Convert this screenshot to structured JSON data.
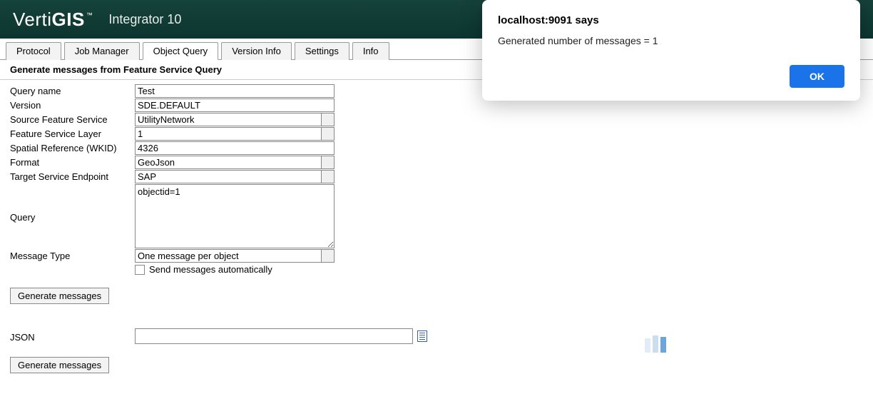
{
  "header": {
    "logo_part1": "Verti",
    "logo_part2": "GIS",
    "trademark": "™",
    "app_name": "Integrator 10"
  },
  "tabs": [
    {
      "label": "Protocol",
      "active": false
    },
    {
      "label": "Job Manager",
      "active": false
    },
    {
      "label": "Object Query",
      "active": true
    },
    {
      "label": "Version Info",
      "active": false
    },
    {
      "label": "Settings",
      "active": false
    },
    {
      "label": "Info",
      "active": false
    }
  ],
  "panel": {
    "title": "Generate messages from Feature Service Query"
  },
  "form": {
    "query_name": {
      "label": "Query name",
      "value": "Test"
    },
    "version": {
      "label": "Version",
      "value": "SDE.DEFAULT"
    },
    "source_fs": {
      "label": "Source Feature Service",
      "value": "UtilityNetwork"
    },
    "fs_layer": {
      "label": "Feature Service Layer",
      "value": "1"
    },
    "wkid": {
      "label": "Spatial Reference (WKID)",
      "value": "4326"
    },
    "format": {
      "label": "Format",
      "value": "GeoJson"
    },
    "target_ep": {
      "label": "Target Service Endpoint",
      "value": "SAP"
    },
    "query": {
      "label": "Query",
      "value": "objectid=1"
    },
    "msg_type": {
      "label": "Message Type",
      "value": "One message per object"
    },
    "auto_send": {
      "label": "Send messages automatically",
      "checked": false
    },
    "generate_btn": "Generate messages",
    "json_label": "JSON",
    "json_value": "",
    "generate_btn2": "Generate messages"
  },
  "alert": {
    "title": "localhost:9091 says",
    "message": "Generated number of messages = 1",
    "ok": "OK"
  }
}
